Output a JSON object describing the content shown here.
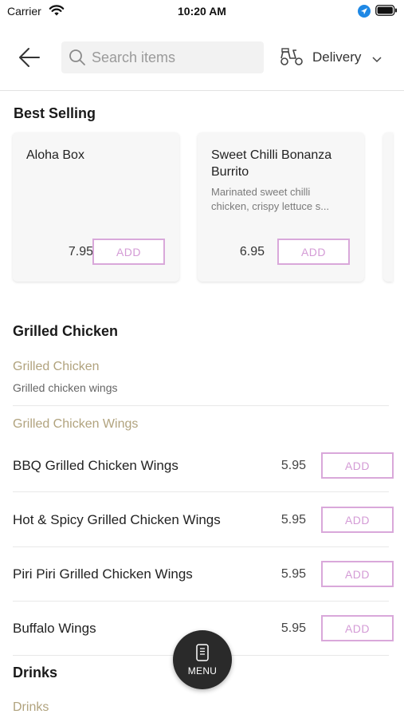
{
  "status_bar": {
    "carrier": "Carrier",
    "time": "10:20 AM"
  },
  "header": {
    "search_placeholder": "Search items",
    "delivery_label": "Delivery"
  },
  "best_selling": {
    "title": "Best Selling",
    "cards": [
      {
        "name": "Aloha Box",
        "description": "",
        "price": "7.95",
        "add_label": "ADD"
      },
      {
        "name": "Sweet Chilli Bonanza Burrito",
        "description": "Marinated sweet chilli chicken, crispy lettuce s...",
        "price": "6.95",
        "add_label": "ADD"
      }
    ]
  },
  "grilled_chicken": {
    "title": "Grilled Chicken",
    "subcategory_1": {
      "name": "Grilled Chicken",
      "description": "Grilled chicken wings"
    },
    "subcategory_2": {
      "name": "Grilled Chicken Wings"
    },
    "items": [
      {
        "name": "BBQ Grilled Chicken Wings",
        "price": "5.95",
        "add_label": "ADD"
      },
      {
        "name": "Hot & Spicy Grilled Chicken Wings",
        "price": "5.95",
        "add_label": "ADD"
      },
      {
        "name": "Piri Piri Grilled Chicken Wings",
        "price": "5.95",
        "add_label": "ADD"
      },
      {
        "name": "Buffalo Wings",
        "price": "5.95",
        "add_label": "ADD"
      }
    ]
  },
  "drinks": {
    "title": "Drinks",
    "subcategory_1": {
      "name": "Drinks"
    }
  },
  "menu_button": {
    "label": "MENU"
  },
  "colors": {
    "accent_add": "#d9a8da",
    "subcategory_text": "#b1a37e",
    "fab_background": "#2a2a2a",
    "location_blue": "#1e88e5"
  },
  "icons": [
    "wifi-icon",
    "location-arrow-icon",
    "battery-icon",
    "back-arrow-icon",
    "search-icon",
    "scooter-icon",
    "chevron-down-icon",
    "menu-book-icon"
  ]
}
